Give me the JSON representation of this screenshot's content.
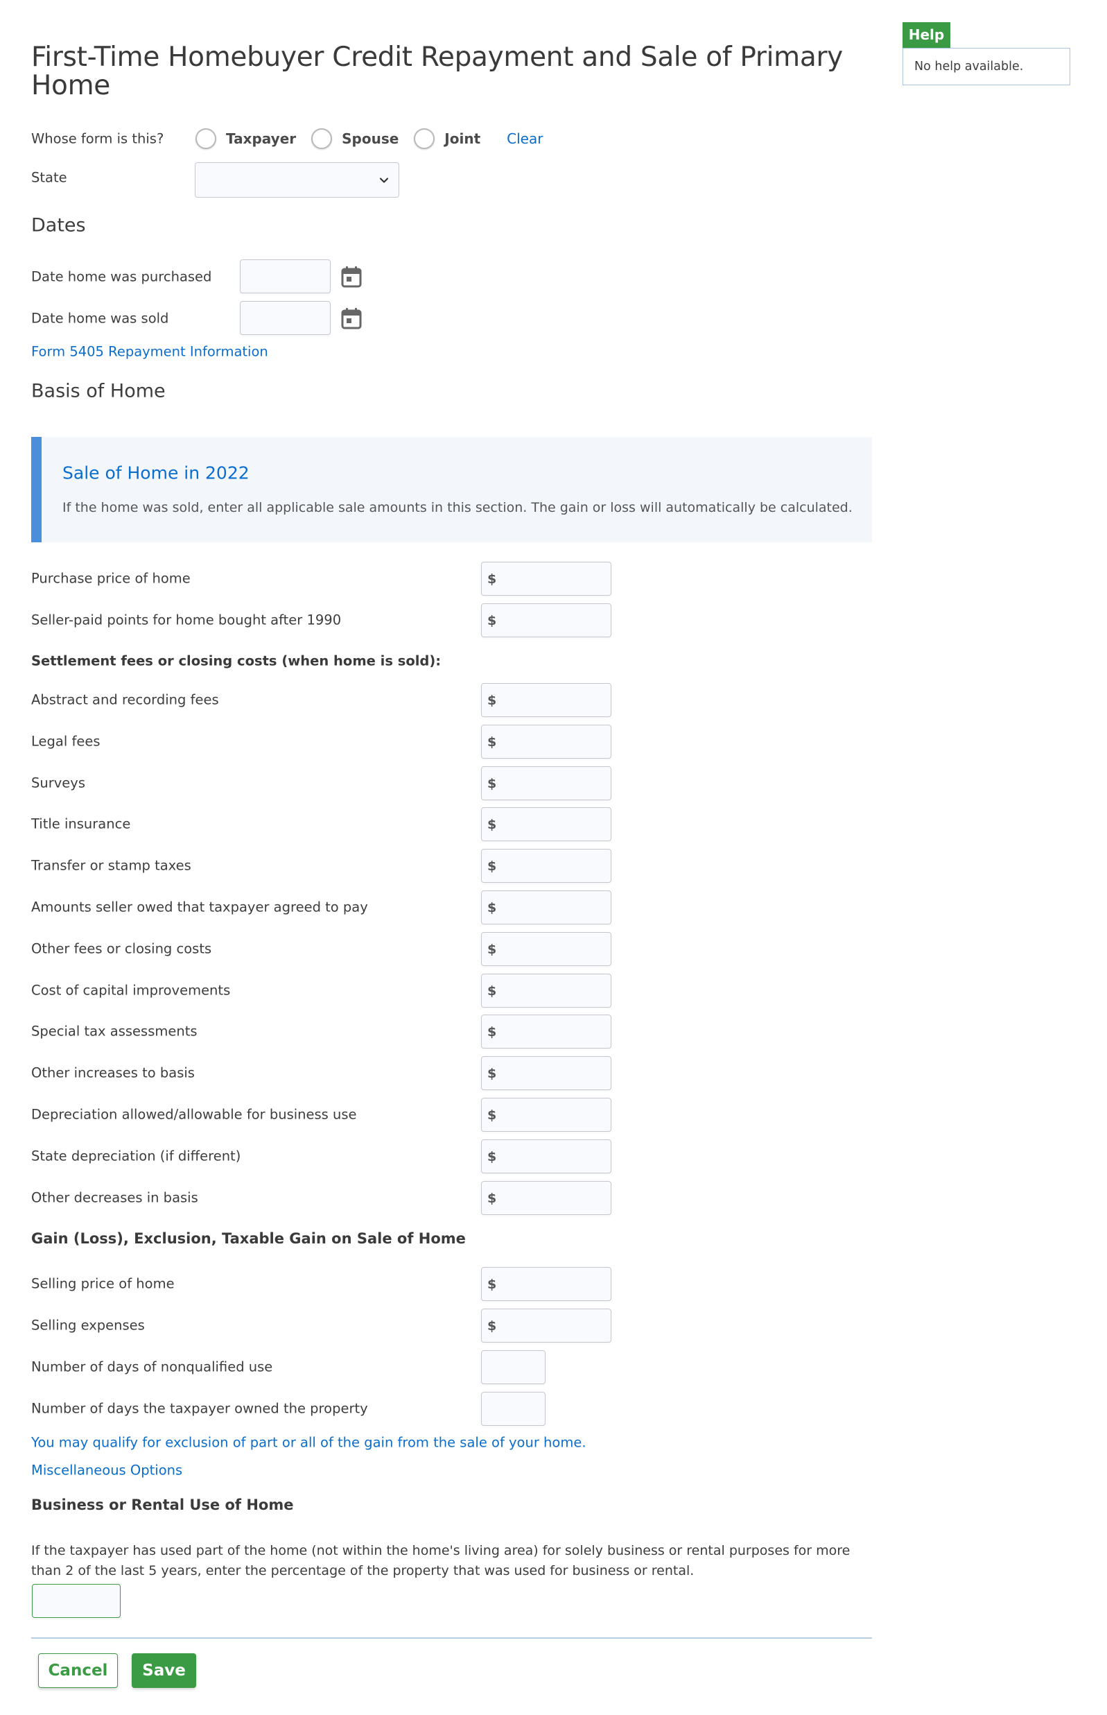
{
  "page": {
    "title": "First-Time Homebuyer Credit Repayment and Sale of Primary Home"
  },
  "help": {
    "tab_label": "Help",
    "text": "No help available."
  },
  "owner": {
    "label": "Whose form is this?",
    "options": [
      {
        "label": "Taxpayer",
        "selected": false
      },
      {
        "label": "Spouse",
        "selected": false
      },
      {
        "label": "Joint",
        "selected": false
      }
    ],
    "clear_label": "Clear"
  },
  "state": {
    "label": "State",
    "value": ""
  },
  "dates": {
    "heading": "Dates",
    "purchased_label": "Date home was purchased",
    "purchased_value": "",
    "sold_label": "Date home was sold",
    "sold_value": "",
    "repayment_link": "Form 5405 Repayment Information"
  },
  "basis": {
    "heading": "Basis of Home",
    "info_title": "Sale of Home in 2022",
    "info_text": "If the home was sold, enter all applicable sale amounts in this section. The gain or loss will automatically be calculated.",
    "currency_symbol": "$",
    "purchase_price_label": "Purchase price of home",
    "seller_points_label": "Seller-paid points for home bought after 1990",
    "settlement_heading": "Settlement fees or closing costs (when home is sold):",
    "fields": [
      {
        "label": "Abstract and recording fees",
        "value": ""
      },
      {
        "label": "Legal fees",
        "value": ""
      },
      {
        "label": "Surveys",
        "value": ""
      },
      {
        "label": "Title insurance",
        "value": ""
      },
      {
        "label": "Transfer or stamp taxes",
        "value": ""
      },
      {
        "label": "Amounts seller owed that taxpayer agreed to pay",
        "value": ""
      },
      {
        "label": "Other fees or closing costs",
        "value": ""
      },
      {
        "label": "Cost of capital improvements",
        "value": ""
      },
      {
        "label": "Special tax assessments",
        "value": ""
      },
      {
        "label": "Other increases to basis",
        "value": ""
      },
      {
        "label": "Depreciation allowed/allowable for business use",
        "value": ""
      },
      {
        "label": "State depreciation (if different)",
        "value": ""
      },
      {
        "label": "Other decreases in basis",
        "value": ""
      }
    ]
  },
  "gain": {
    "heading": "Gain (Loss), Exclusion, Taxable Gain on Sale of Home",
    "selling_price_label": "Selling price of home",
    "selling_expenses_label": "Selling expenses",
    "days_nonqualified_label": "Number of days of nonqualified use",
    "days_owned_label": "Number of days the taxpayer owned the property",
    "exclusion_link": "You may qualify for exclusion of part or all of the gain from the sale of your home.",
    "misc_link": "Miscellaneous Options"
  },
  "business": {
    "heading": "Business or Rental Use of Home",
    "text": "If the taxpayer has used part of the home (not within the home's living area) for solely business or rental purposes for more than 2 of the last 5 years, enter the percentage of the property that was used for business or rental.",
    "percent_value": ""
  },
  "actions": {
    "cancel_label": "Cancel",
    "save_label": "Save"
  },
  "colors": {
    "accent_green": "#3b9b44",
    "link_blue": "#0b6dcc",
    "info_border": "#4a8fdb"
  }
}
